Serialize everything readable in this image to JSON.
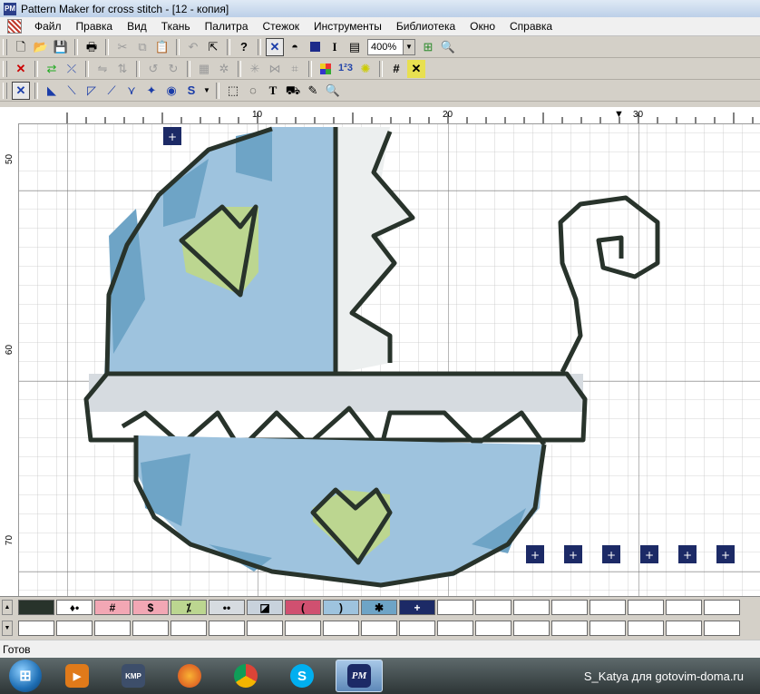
{
  "window": {
    "title": "Pattern Maker for cross stitch - [12 - копия]"
  },
  "menu": {
    "items": [
      "Файл",
      "Правка",
      "Вид",
      "Ткань",
      "Палитра",
      "Стежок",
      "Инструменты",
      "Библиотека",
      "Окно",
      "Справка"
    ]
  },
  "toolbar": {
    "zoom_value": "400%",
    "stitch_icon": "I"
  },
  "ruler": {
    "h_labels": [
      "10",
      "20",
      "30"
    ],
    "v_labels": [
      "50",
      "60",
      "70"
    ]
  },
  "palette": {
    "symbols": [
      "",
      "♦•",
      "#",
      "$",
      "⁒",
      "••",
      "◪",
      "(",
      ")",
      "✱",
      "+"
    ],
    "colors": [
      "#28332b",
      "#ffffff",
      "#f2a7b4",
      "#f2a7b4",
      "#bcd690",
      "#d6dbe0",
      "#c8d2dc",
      "#d05070",
      "#9ec3de",
      "#6ea4c6",
      "#1c2a66"
    ]
  },
  "status": {
    "text": "Готов"
  },
  "taskbar": {
    "pm_label": "PM",
    "watermark": "S_Katya для gotovim-doma.ru"
  },
  "icon_names": [
    "new-file-icon",
    "open-folder-icon",
    "save-icon",
    "print-icon",
    "cut-icon",
    "copy-icon",
    "paste-icon",
    "undo-icon",
    "help-icon",
    "cross-stitch-icon",
    "zoom-icon",
    "select-icon",
    "lasso-icon",
    "text-icon",
    "fill-icon",
    "eyedropper-icon"
  ]
}
